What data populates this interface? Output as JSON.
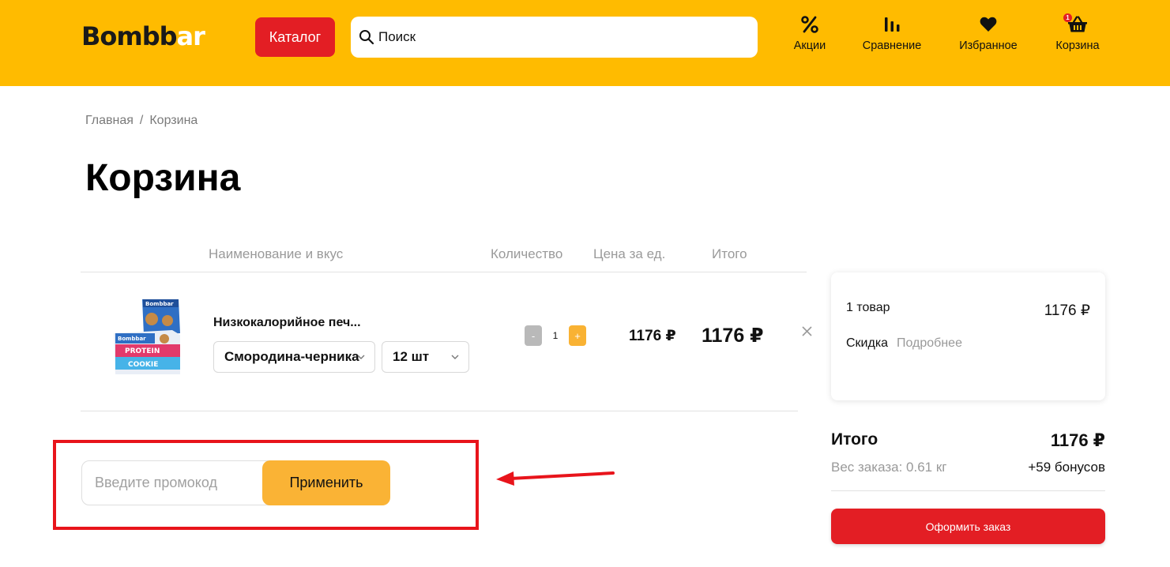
{
  "header": {
    "logo_main": "Bombb",
    "logo_accent": "ar",
    "catalog_label": "Каталог",
    "search_placeholder": "Поиск",
    "nav": [
      {
        "label": "Акции",
        "icon": "percent-icon"
      },
      {
        "label": "Сравнение",
        "icon": "compare-icon"
      },
      {
        "label": "Избранное",
        "icon": "heart-icon"
      },
      {
        "label": "Корзина",
        "icon": "basket-icon",
        "badge": "1"
      }
    ]
  },
  "breadcrumb": {
    "home": "Главная",
    "separator": "/",
    "current": "Корзина"
  },
  "page_title": "Корзина",
  "table": {
    "headers": [
      "Наименование и вкус",
      "Количество",
      "Цена за ед.",
      "Итого"
    ]
  },
  "cart_item": {
    "name": "Низкокалорийное печ...",
    "flavor": "Смородина-черника",
    "pack": "12 шт",
    "quantity": "1",
    "minus_label": "-",
    "plus_label": "+",
    "unit_price": "1176 ₽",
    "total_price": "1176 ₽",
    "image_text_brand": "Bombbar",
    "image_text_1": "PROTEIN",
    "image_text_2": "COOKIE"
  },
  "promo": {
    "placeholder": "Введите промокод",
    "apply_label": "Применить"
  },
  "summary": {
    "count_label": "1 товар",
    "count_price": "1176 ₽",
    "discount_label": "Скидка",
    "discount_more": "Подробнее",
    "total_label": "Итого",
    "total_value": "1176 ₽",
    "weight": "Вес заказа: 0.61 кг",
    "bonus": "+59 бонусов",
    "order_label": "Оформить заказ"
  },
  "colors": {
    "brand_yellow": "#FFBB00",
    "brand_red": "#E31E24",
    "accent_orange": "#FAB335",
    "annotation_red": "#E8141B"
  }
}
